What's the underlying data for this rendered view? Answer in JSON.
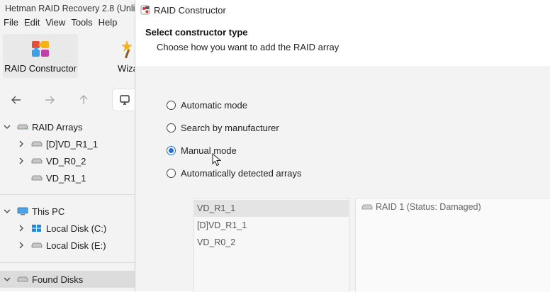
{
  "main_window": {
    "title": "Hetman RAID Recovery 2.8 (Unli",
    "menu": [
      "File",
      "Edit",
      "View",
      "Tools",
      "Help"
    ],
    "toolbar": {
      "raid_constructor": "RAID Constructor",
      "wizard": "Wiza"
    },
    "tree": {
      "raid_arrays": "RAID Arrays",
      "raid_children": [
        "[D]VD_R1_1",
        "VD_R0_2",
        "VD_R1_1"
      ],
      "this_pc": "This PC",
      "pc_children": [
        "Local Disk (C:)",
        "Local Disk (E:)"
      ],
      "found_disks": "Found Disks"
    }
  },
  "dialog": {
    "title": "RAID Constructor",
    "heading": "Select constructor type",
    "subheading": "Choose how you want to add the RAID array",
    "options": [
      {
        "label": "Automatic mode",
        "checked": false
      },
      {
        "label": "Search by manufacturer",
        "checked": false
      },
      {
        "label": "Manual mode",
        "checked": true
      },
      {
        "label": "Automatically detected arrays",
        "checked": false
      }
    ],
    "arrays_list": [
      "VD_R1_1",
      "[D]VD_R1_1",
      "VD_R0_2"
    ],
    "selected_array_index": 0,
    "array_info": "RAID 1 (Status: Damaged)"
  },
  "colors": {
    "accent": "#1f6fd6",
    "selection": "#e4e4e4",
    "panel": "#f3f3f3"
  }
}
